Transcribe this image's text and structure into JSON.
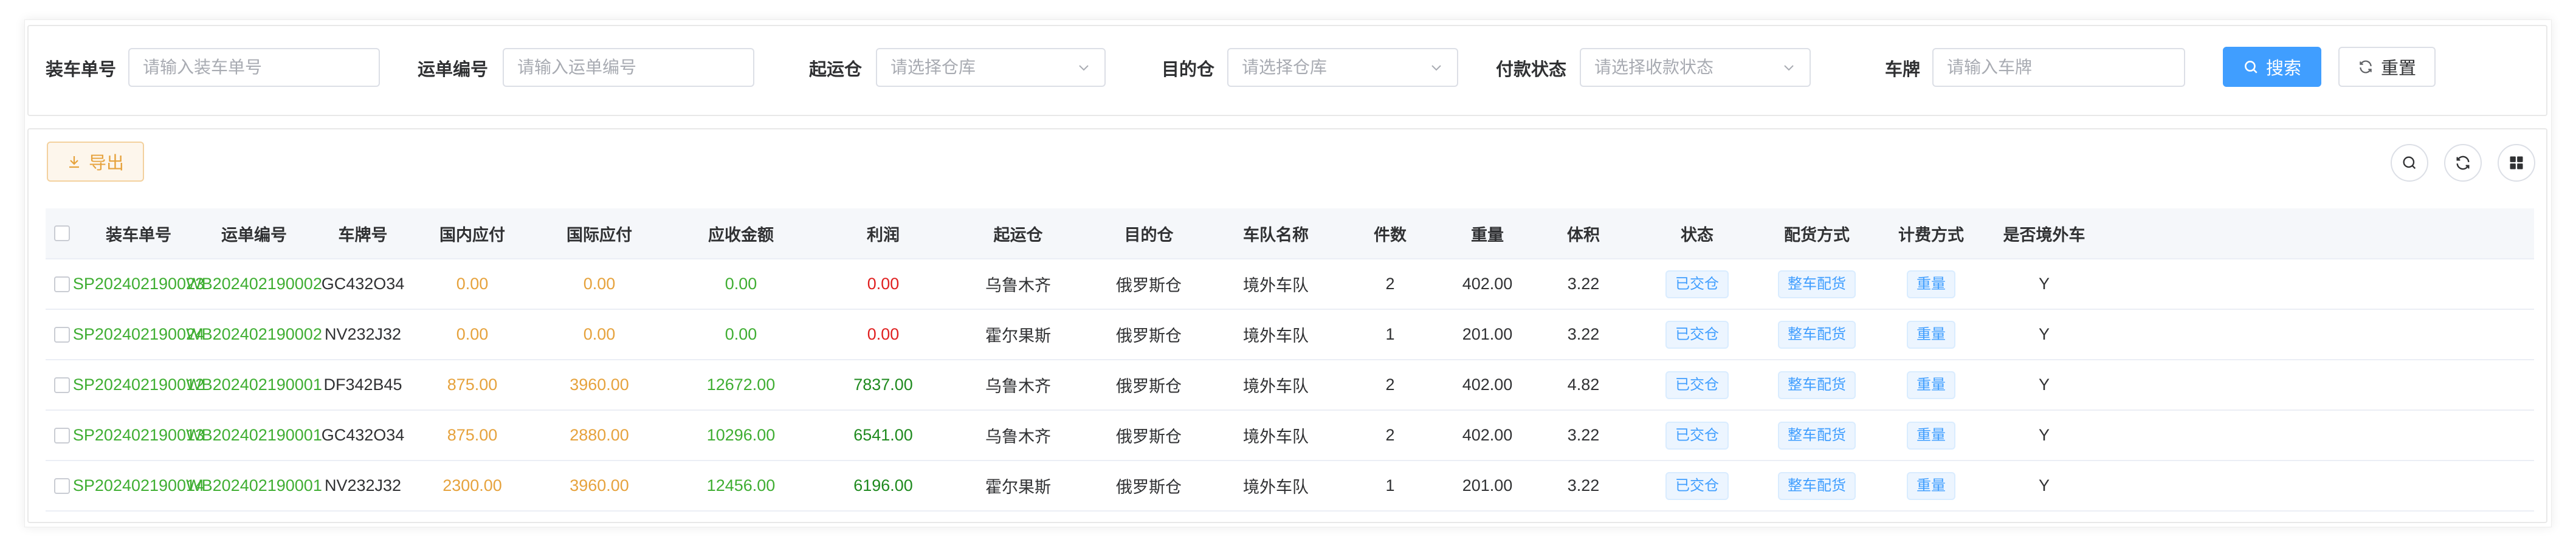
{
  "search": {
    "fields": [
      {
        "label": "装车单号",
        "type": "input",
        "placeholder": "请输入装车单号"
      },
      {
        "label": "运单编号",
        "type": "input",
        "placeholder": "请输入运单编号"
      },
      {
        "label": "起运仓",
        "type": "select",
        "placeholder": "请选择仓库"
      },
      {
        "label": "目的仓",
        "type": "select",
        "placeholder": "请选择仓库"
      },
      {
        "label": "付款状态",
        "type": "select",
        "placeholder": "请选择收款状态"
      },
      {
        "label": "车牌",
        "type": "input",
        "placeholder": "请输入车牌"
      }
    ],
    "search_label": "搜索",
    "reset_label": "重置"
  },
  "toolbar": {
    "export_label": "导出",
    "tools": [
      "search-icon",
      "refresh-icon",
      "grid-icon"
    ]
  },
  "colors": {
    "primary": "#409eff",
    "link_green": "#3fae32",
    "amount_orange": "#e6a23c",
    "profit_red": "#e02020",
    "profit_green": "#1e8a1e"
  },
  "table": {
    "columns": [
      "装车单号",
      "运单编号",
      "车牌号",
      "国内应付",
      "国际应付",
      "应收金额",
      "利润",
      "起运仓",
      "目的仓",
      "车队名称",
      "件数",
      "重量",
      "体积",
      "状态",
      "配货方式",
      "计费方式",
      "是否境外车"
    ],
    "rows": [
      [
        "SP202402190023",
        "WB202402190002",
        "GC432O34",
        "0.00",
        "0.00",
        "0.00",
        "0.00",
        "乌鲁木齐",
        "俄罗斯仓",
        "境外车队",
        "2",
        "402.00",
        "3.22",
        "已交仓",
        "整车配货",
        "重量",
        "Y"
      ],
      [
        "SP202402190024",
        "WB202402190002",
        "NV232J32",
        "0.00",
        "0.00",
        "0.00",
        "0.00",
        "霍尔果斯",
        "俄罗斯仓",
        "境外车队",
        "1",
        "201.00",
        "3.22",
        "已交仓",
        "整车配货",
        "重量",
        "Y"
      ],
      [
        "SP202402190012",
        "WB202402190001",
        "DF342B45",
        "875.00",
        "3960.00",
        "12672.00",
        "7837.00",
        "乌鲁木齐",
        "俄罗斯仓",
        "境外车队",
        "2",
        "402.00",
        "4.82",
        "已交仓",
        "整车配货",
        "重量",
        "Y"
      ],
      [
        "SP202402190013",
        "WB202402190001",
        "GC432O34",
        "875.00",
        "2880.00",
        "10296.00",
        "6541.00",
        "乌鲁木齐",
        "俄罗斯仓",
        "境外车队",
        "2",
        "402.00",
        "3.22",
        "已交仓",
        "整车配货",
        "重量",
        "Y"
      ],
      [
        "SP202402190014",
        "WB202402190001",
        "NV232J32",
        "2300.00",
        "3960.00",
        "12456.00",
        "6196.00",
        "霍尔果斯",
        "俄罗斯仓",
        "境外车队",
        "1",
        "201.00",
        "3.22",
        "已交仓",
        "整车配货",
        "重量",
        "Y"
      ]
    ]
  }
}
